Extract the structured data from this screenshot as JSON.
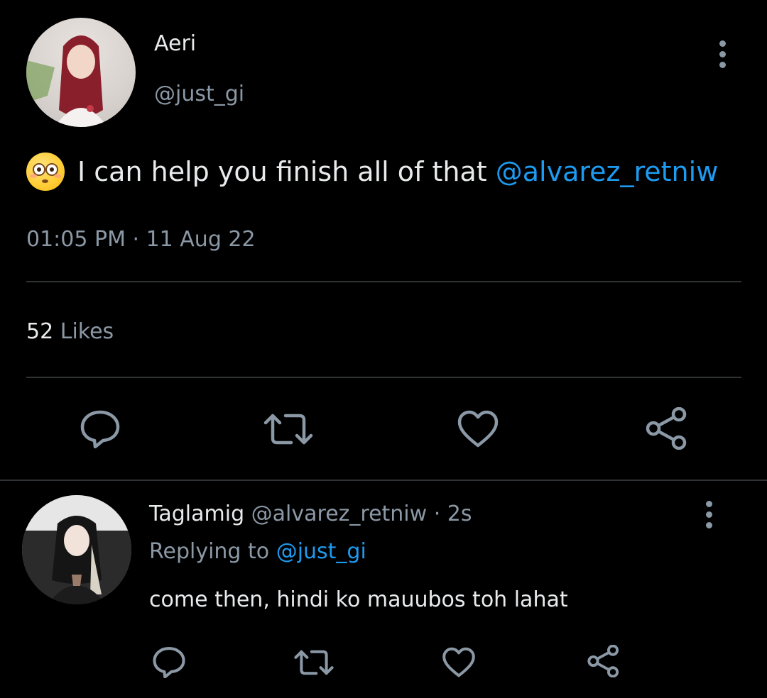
{
  "tweet": {
    "author_name": "Aeri",
    "author_handle": "@just_gi",
    "text": "I can help you finish all of that",
    "mention": "@alvarez_retniw",
    "timestamp": "01:05 PM · 11 Aug 22",
    "likes_count": "52",
    "likes_label": "Likes"
  },
  "reply": {
    "author_name": "Taglamig",
    "author_handle": "@alvarez_retniw",
    "time_ago": "· 2s",
    "replying_label": "Replying to",
    "replying_to": "@just_gi",
    "text": "come then, hindi ko mauubos toh lahat"
  },
  "icons": {
    "reply": "reply-icon",
    "retweet": "retweet-icon",
    "like": "heart-icon",
    "share": "share-icon",
    "more": "more-icon"
  },
  "colors": {
    "background": "#000000",
    "text": "#e8eaec",
    "muted": "#8b98a5",
    "accent": "#1d9bf0",
    "divider": "#2f3336"
  }
}
